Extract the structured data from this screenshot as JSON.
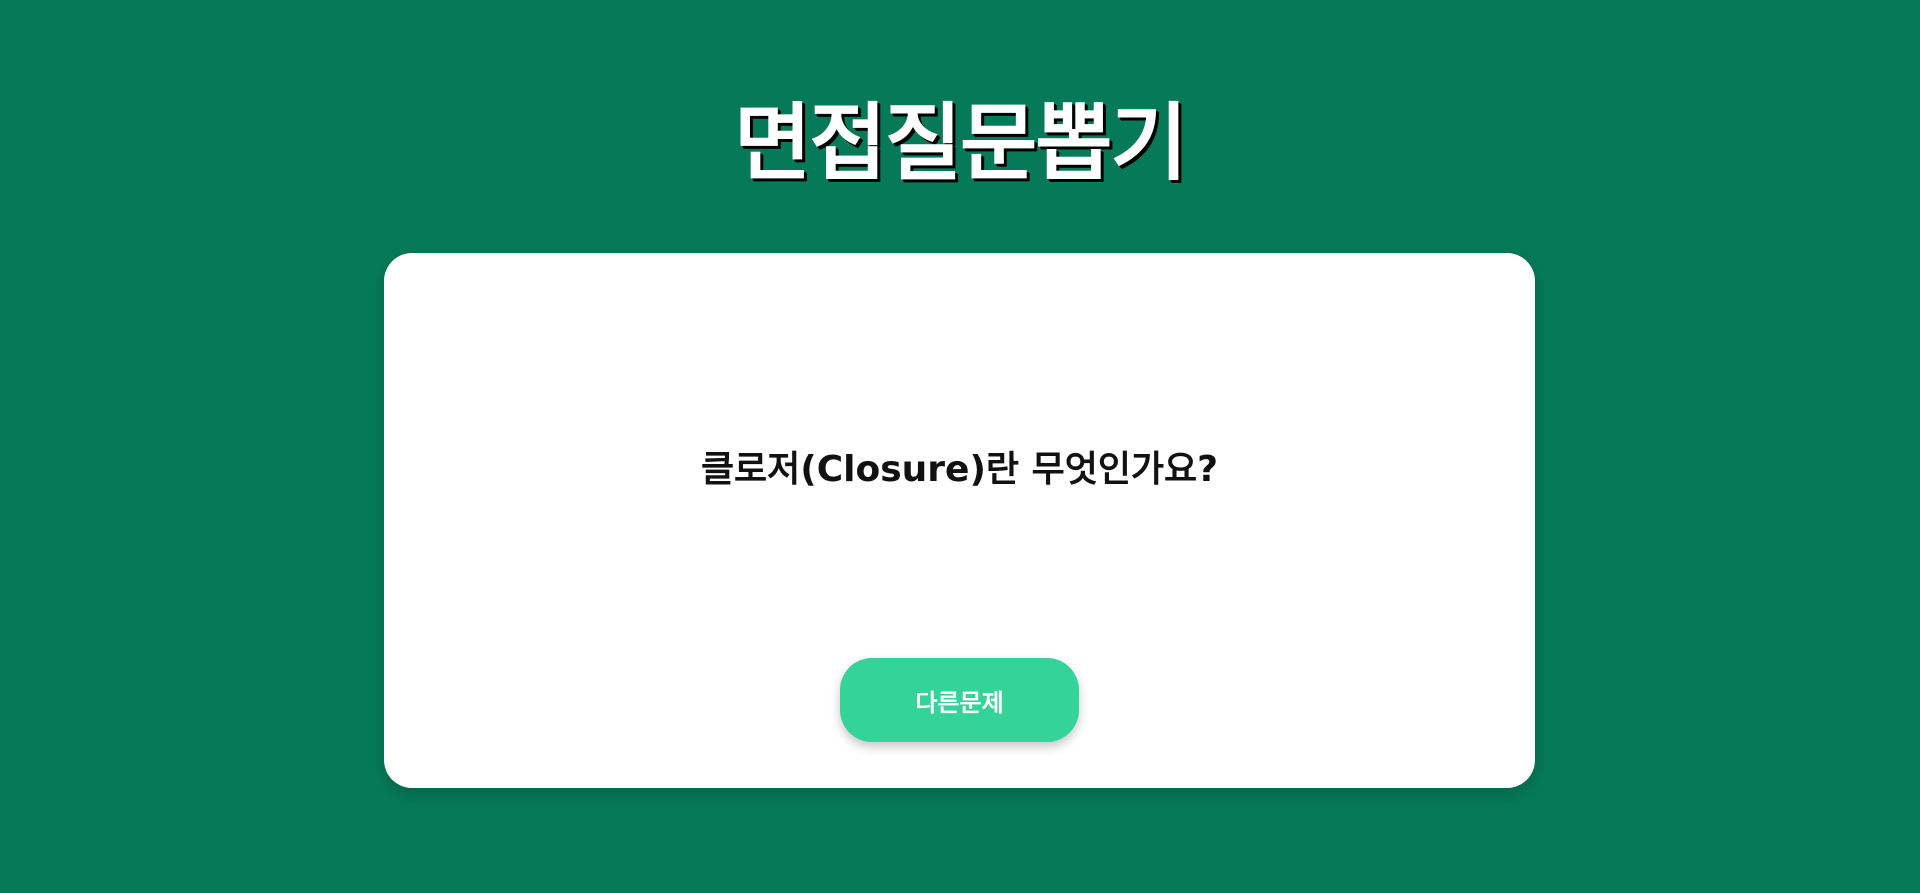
{
  "header": {
    "title": "면접질문뽑기"
  },
  "card": {
    "question": "클로저(Closure)란 무엇인가요?",
    "next_button_label": "다른문제"
  },
  "colors": {
    "background": "#067a58",
    "card": "#ffffff",
    "button": "#34d399",
    "title_text": "#ffffff",
    "question_text": "#111111"
  }
}
